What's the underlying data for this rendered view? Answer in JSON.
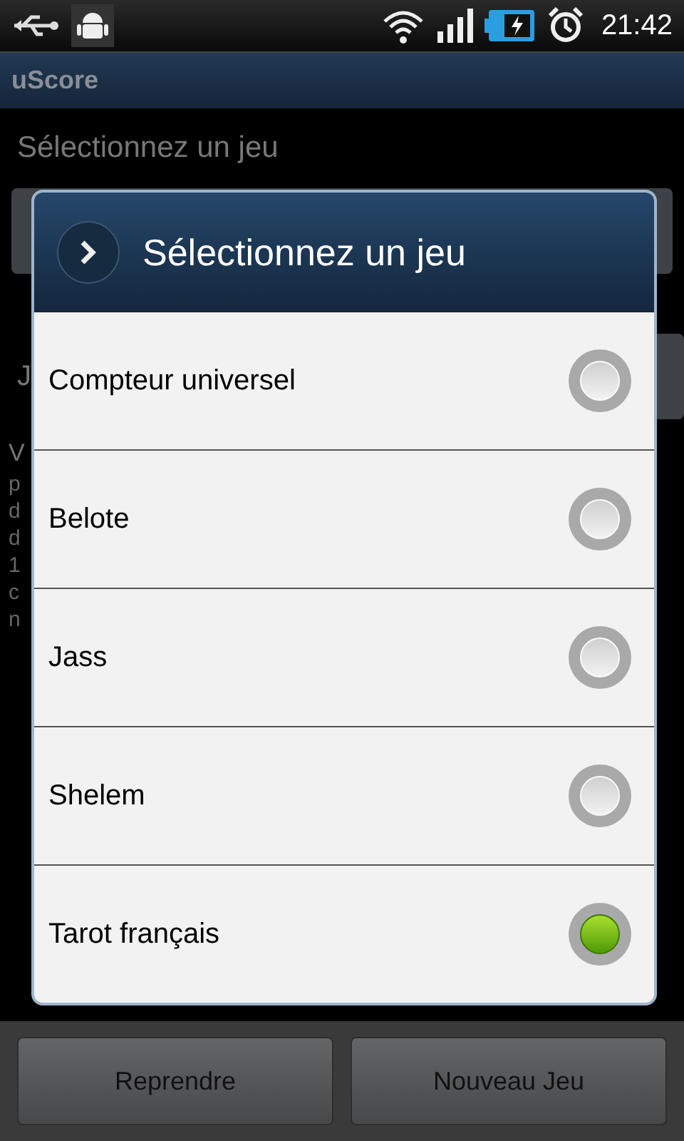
{
  "status_bar": {
    "time": "21:42"
  },
  "app_bar": {
    "title": "uScore"
  },
  "background": {
    "label": "Sélectionnez un jeu",
    "button_fragment": "J",
    "text_fragments": [
      "V",
      "p",
      "d",
      "d",
      "1",
      "c",
      "n"
    ]
  },
  "dialog": {
    "title": "Sélectionnez un jeu",
    "options": [
      {
        "label": "Compteur universel",
        "selected": false
      },
      {
        "label": "Belote",
        "selected": false
      },
      {
        "label": "Jass",
        "selected": false
      },
      {
        "label": "Shelem",
        "selected": false
      },
      {
        "label": "Tarot français",
        "selected": true
      }
    ]
  },
  "buttons": [
    "Reprendre",
    "Nouveau Jeu"
  ]
}
